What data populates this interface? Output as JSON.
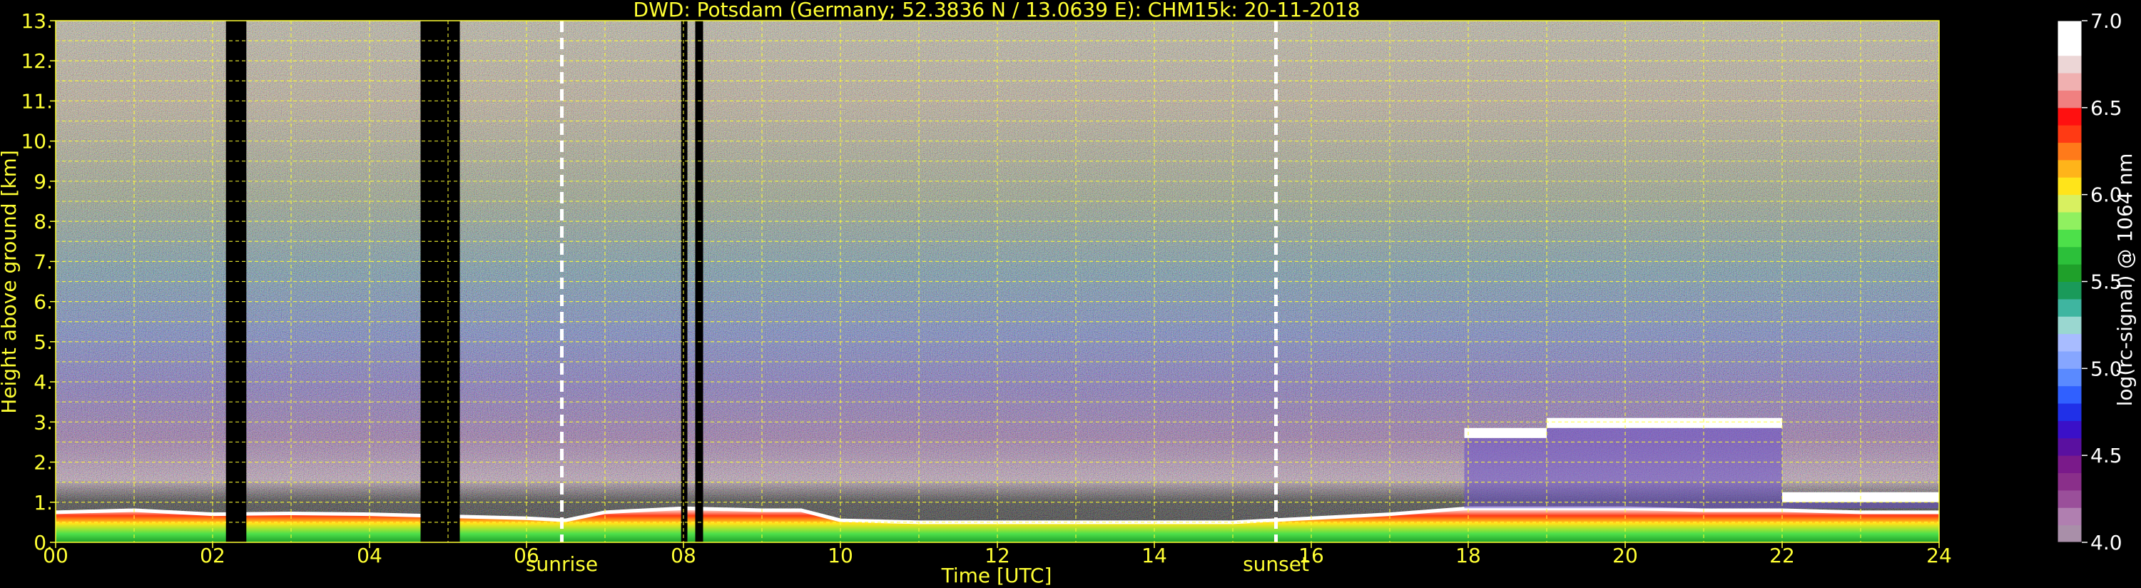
{
  "chart_data": {
    "type": "heatmap",
    "title": "DWD: Potsdam (Germany; 52.3836 N / 13.0639 E):    CHM15k: 20-11-2018",
    "xlabel": "Time [UTC]",
    "ylabel": "Height above ground [km]",
    "xlim": [
      0,
      24
    ],
    "ylim": [
      0,
      13
    ],
    "x_ticks": [
      0,
      2,
      4,
      6,
      8,
      10,
      12,
      14,
      16,
      18,
      20,
      22,
      24
    ],
    "x_tick_labels": [
      "00",
      "02",
      "04",
      "06",
      "08",
      "10",
      "12",
      "14",
      "16",
      "18",
      "20",
      "22",
      "24"
    ],
    "y_ticks": [
      0,
      1,
      2,
      3,
      4,
      5,
      6,
      7,
      8,
      9,
      10,
      11,
      12,
      13
    ],
    "y_tick_labels": [
      "0.",
      "1.",
      "2.",
      "3.",
      "4.",
      "5.",
      "6.",
      "7.",
      "8.",
      "9.",
      "10.",
      "11.",
      "12.",
      "13."
    ],
    "grid": true,
    "colorbar": {
      "label": "log(rc-signal) @ 1064 nm",
      "range": [
        4.0,
        7.0
      ],
      "ticks": [
        4.0,
        4.5,
        5.0,
        5.5,
        6.0,
        6.5,
        7.0
      ],
      "tick_labels": [
        "4.0",
        "4.5",
        "5.0",
        "5.5",
        "6.0",
        "6.5",
        "7.0"
      ],
      "colors": [
        "#a98fa9",
        "#b07fb0",
        "#9a4f9a",
        "#8a2f8a",
        "#7a1a8a",
        "#5a10a0",
        "#3a10c8",
        "#2030e8",
        "#3060ff",
        "#5a8aff",
        "#86a6ff",
        "#a8bcff",
        "#9ad7d0",
        "#3fb5a0",
        "#1a9a5a",
        "#1fa02a",
        "#2cc03a",
        "#4de04a",
        "#90f060",
        "#d8f060",
        "#ffe41a",
        "#ffb41a",
        "#ff7a1a",
        "#ff3a14",
        "#ff1010",
        "#f08080",
        "#f0b0b0",
        "#ecd6d6",
        "#ffffff",
        "#ffffff"
      ]
    },
    "events": [
      {
        "label": "sunrise",
        "time": 6.45
      },
      {
        "label": "sunset",
        "time": 15.55
      }
    ],
    "data_gaps": [
      {
        "start": 2.17,
        "end": 2.43
      },
      {
        "start": 4.65,
        "end": 5.15
      },
      {
        "start": 7.97,
        "end": 8.05
      },
      {
        "start": 8.15,
        "end": 8.25
      }
    ],
    "boundary_layer_top": {
      "x": [
        0,
        1,
        2,
        3,
        4,
        5,
        6,
        6.5,
        7,
        8,
        9,
        9.5,
        10,
        11,
        12,
        13,
        14,
        15,
        16,
        17,
        18,
        19,
        20,
        21,
        22,
        23,
        24
      ],
      "y": [
        0.75,
        0.8,
        0.7,
        0.72,
        0.7,
        0.65,
        0.6,
        0.55,
        0.75,
        0.85,
        0.8,
        0.8,
        0.55,
        0.5,
        0.5,
        0.5,
        0.5,
        0.5,
        0.6,
        0.7,
        0.85,
        0.85,
        0.85,
        0.8,
        0.8,
        0.75,
        0.75
      ]
    },
    "cloud_layers": [
      {
        "x_start": 17.95,
        "x_end": 19.0,
        "base": 2.6,
        "top": 2.85
      },
      {
        "x_start": 19.0,
        "x_end": 22.0,
        "base": 2.85,
        "top": 3.1
      },
      {
        "x_start": 22.0,
        "x_end": 24.0,
        "base": 1.0,
        "top": 1.25
      }
    ]
  }
}
